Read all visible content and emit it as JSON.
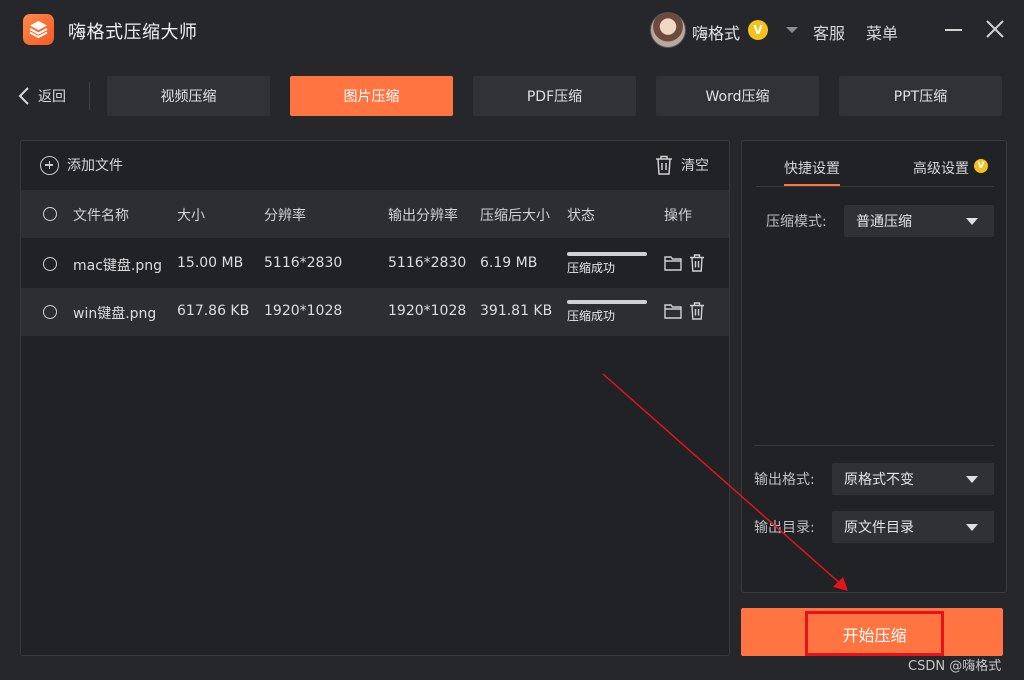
{
  "app": {
    "title": "嗨格式压缩大师",
    "user_name": "嗨格式",
    "vip_badge": "V",
    "service_label": "客服",
    "menu_label": "菜单"
  },
  "nav": {
    "back_label": "返回",
    "tabs": [
      {
        "label": "视频压缩",
        "active": false
      },
      {
        "label": "图片压缩",
        "active": true
      },
      {
        "label": "PDF压缩",
        "active": false
      },
      {
        "label": "Word压缩",
        "active": false
      },
      {
        "label": "PPT压缩",
        "active": false
      }
    ]
  },
  "toolbar": {
    "add_file_label": "添加文件",
    "clear_label": "清空"
  },
  "table": {
    "headers": {
      "name": "文件名称",
      "size": "大小",
      "resolution": "分辨率",
      "output_resolution": "输出分辨率",
      "compressed_size": "压缩后大小",
      "status": "状态",
      "actions": "操作"
    },
    "rows": [
      {
        "name": "mac键盘.png",
        "size": "15.00 MB",
        "resolution": "5116*2830",
        "output_resolution": "5116*2830",
        "compressed_size": "6.19 MB",
        "status": "压缩成功",
        "progress": 1.0
      },
      {
        "name": "win键盘.png",
        "size": "617.86 KB",
        "resolution": "1920*1028",
        "output_resolution": "1920*1028",
        "compressed_size": "391.81 KB",
        "status": "压缩成功",
        "progress": 1.0
      }
    ]
  },
  "settings": {
    "quick_tab": "快捷设置",
    "advanced_tab": "高级设置",
    "advanced_badge": "V",
    "mode_label": "压缩模式:",
    "mode_value": "普通压缩",
    "format_label": "输出格式:",
    "format_value": "原格式不变",
    "dir_label": "输出目录:",
    "dir_value": "原文件目录"
  },
  "start_button": "开始压缩",
  "watermark": "CSDN @嗨格式",
  "colors": {
    "accent": "#ff7440",
    "background": "#25272b",
    "panel": "#202225",
    "highlight_box": "#e5141a",
    "vip_gold": "#f4c21a"
  }
}
